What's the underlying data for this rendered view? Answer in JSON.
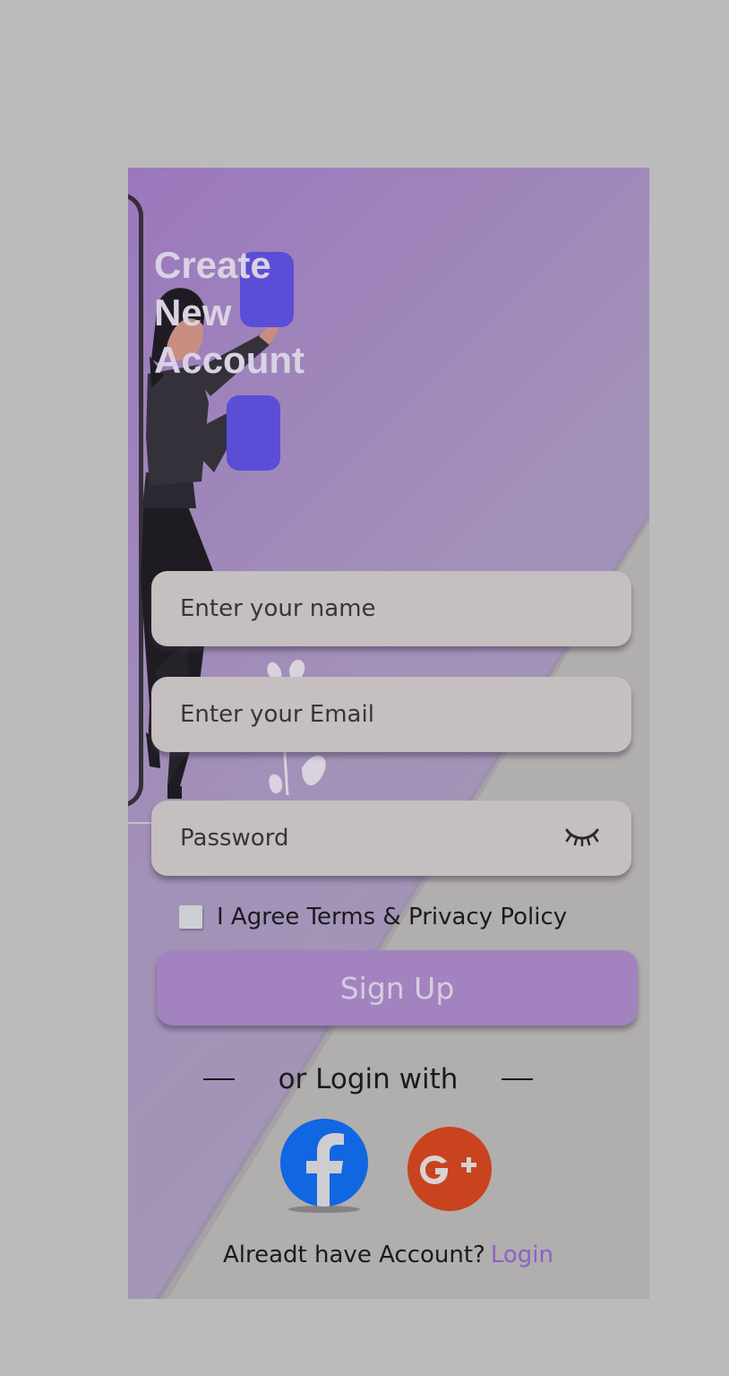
{
  "title": {
    "line1": "Create",
    "line2": "New",
    "line3": "Account"
  },
  "form": {
    "name_placeholder": "Enter your name",
    "email_placeholder": "Enter your Email",
    "password_placeholder": "Password",
    "agree_label": "I Agree Terms & Privacy Policy",
    "signup_label": "Sign Up"
  },
  "social": {
    "divider_label": "or Login with",
    "providers": [
      "facebook-icon",
      "google-plus-icon"
    ]
  },
  "footer": {
    "prompt": "Alreadt have Account?",
    "login_label": "Login"
  },
  "colors": {
    "accent": "#8f61c4",
    "button": "#a383bf",
    "field": "#c5bfc0",
    "facebook": "#1166e2",
    "google_plus": "#c9431e"
  }
}
